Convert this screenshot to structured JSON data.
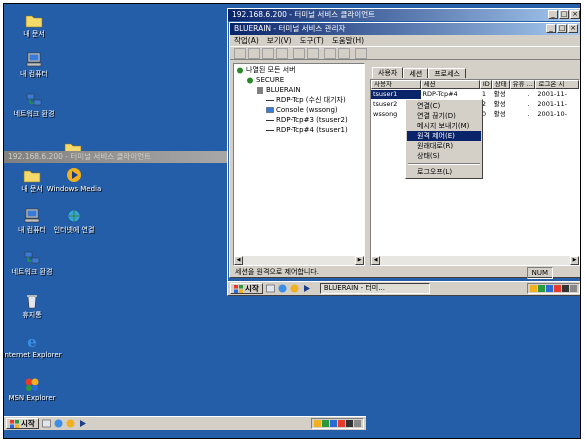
{
  "desktop_back": {
    "icons": [
      {
        "label": "내 문서"
      },
      {
        "label": "내 컴퓨터"
      },
      {
        "label": "네트워크 환경"
      }
    ]
  },
  "desktop_front": {
    "icons": [
      {
        "label": "내 문서"
      },
      {
        "label": "Windows Media"
      },
      {
        "label": "내 컴퓨터"
      },
      {
        "label": "인터넷에 연결"
      },
      {
        "label": "네트워크 환경"
      },
      {
        "label": "휴지통"
      },
      {
        "label": "Internet Explorer"
      },
      {
        "label": "MSN Explorer"
      }
    ]
  },
  "rdp_back": {
    "title": "192.168.6.200 - 터미널 서비스 클라이언트"
  },
  "rdp_front": {
    "title": "192.168.6.200 - 터미널 서비스 클라이언트"
  },
  "tsm": {
    "title": "BLUERAIN - 터미널 서비스 관리자",
    "menu": [
      "작업(A)",
      "보기(V)",
      "도구(T)",
      "도움말(H)"
    ],
    "tree": [
      {
        "label": "나열된 모든 서버"
      },
      {
        "label": "SECURE"
      },
      {
        "label": "BLUERAIN"
      },
      {
        "label": "RDP-Tcp (수신 대기자)"
      },
      {
        "label": "Console (wssong)"
      },
      {
        "label": "RDP-Tcp#3 (tsuser2)"
      },
      {
        "label": "RDP-Tcp#4 (tsuser1)"
      }
    ],
    "tabs": [
      "사용자",
      "세션",
      "프로세스"
    ],
    "columns": [
      "사용자",
      "세션",
      "ID",
      "상태",
      "유휴 ...",
      "로그온 시"
    ],
    "rows": [
      {
        "user": "tsuser1",
        "session": "RDP-Tcp#4",
        "id": "1",
        "state": "활성",
        "idle": ".",
        "logon": "2001-11-"
      },
      {
        "user": "tsuser2",
        "session": "",
        "id": "2",
        "state": "활성",
        "idle": ".",
        "logon": "2001-11-"
      },
      {
        "user": "wssong",
        "session": "",
        "id": "0",
        "state": "활성",
        "idle": ".",
        "logon": "2001-10-"
      }
    ],
    "context_menu": [
      "연결(C)",
      "연결 끊기(D)",
      "메시지 보내기(M)",
      "원격 제어(E)",
      "원래대로(R)",
      "상태(S)",
      "로그오프(L)"
    ],
    "status": "세션을 원격으로 제어합니다.",
    "status_num": "NUM"
  },
  "taskbar_inner": {
    "start": "시작",
    "task": "BLUERAIN - 터미...",
    "clock": ""
  },
  "taskbar_outer": {
    "start": "시작",
    "clock": ""
  }
}
